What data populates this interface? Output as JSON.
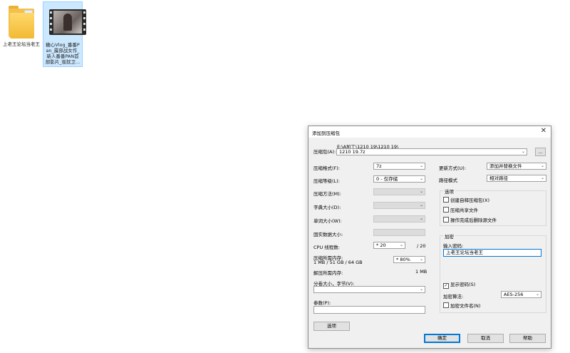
{
  "desktop": {
    "icons": [
      {
        "label": "上老王论坛当老王"
      },
      {
        "label": "糖心Vlog_番番Pan_露部战女作_新人番番PAN首部影片_坂就卫..."
      }
    ]
  },
  "dialog": {
    "title": "添加到压缩包",
    "archive_label": "压缩包(A):",
    "archive_path": "E:\\A加工\\1210 19\\1210 19\\",
    "archive_name": "1210 19.7z",
    "browse_label": "...",
    "format_label": "压缩格式(F):",
    "format_value": "7z",
    "level_label": "压缩等级(L):",
    "level_value": "0 - 仅存储",
    "method_label": "压缩方法(M):",
    "dict_label": "字典大小(D):",
    "word_label": "单词大小(W):",
    "solid_label": "固实数据大小:",
    "cpu_label": "CPU 线程数:",
    "cpu_value": "* 20",
    "cpu_total": "/ 20",
    "mem_label": "压缩所需内存:",
    "mem_detail": "1 MB / 51 GB / 64 GB",
    "mem_value": "* 80%",
    "decomp_label": "解压所需内存:",
    "decomp_value": "1 MB",
    "split_label": "分卷大小，字节(V):",
    "params_label": "参数(P):",
    "options_button": "选项",
    "update_label": "更新方式(U):",
    "update_value": "添加并替换文件",
    "path_label": "路径模式",
    "path_value": "相对路径",
    "options_group": "选项",
    "opt_sfx": "创建自释压缩包(X)",
    "opt_shared": "压缩共享文件",
    "opt_delete": "操作完成后删除源文件",
    "encrypt_group": "加密",
    "password_label": "输入密码:",
    "password_value": "上老王论坛当老王",
    "show_password": "显示密码(S)",
    "method_enc_label": "加密算法:",
    "method_enc_value": "AES-256",
    "encrypt_names": "加密文件名(N)",
    "ok": "确定",
    "cancel": "取消",
    "help": "帮助"
  }
}
